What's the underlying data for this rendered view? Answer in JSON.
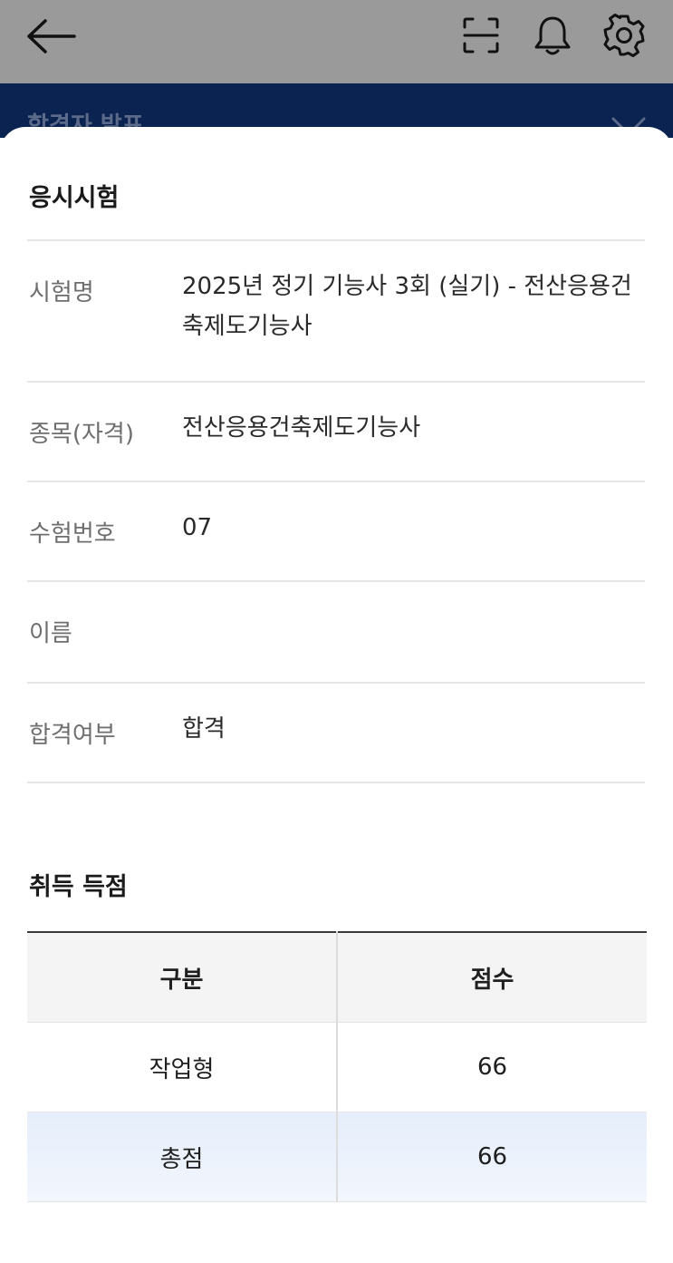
{
  "header": {
    "back_icon": "arrow-left-icon",
    "scan_icon": "scan-icon",
    "bell_icon": "bell-icon",
    "gear_icon": "gear-icon"
  },
  "behind_title": "합격자 발표",
  "exam": {
    "section_title": "응시시험",
    "rows": [
      {
        "label": "시험명",
        "value": "2025년 정기 기능사 3회 (실기) - 전산응용건축제도기능사"
      },
      {
        "label": "종목(자격)",
        "value": "전산응용건축제도기능사"
      },
      {
        "label": "수험번호",
        "value": "07"
      },
      {
        "label": "이름",
        "value": ""
      },
      {
        "label": "합격여부",
        "value": "합격"
      }
    ]
  },
  "scores": {
    "section_title": "취득 득점",
    "headers": [
      "구분",
      "점수"
    ],
    "rows": [
      {
        "category": "작업형",
        "score": "66"
      },
      {
        "category": "총점",
        "score": "66"
      }
    ]
  },
  "colors": {
    "topbar": "#9a9a9a",
    "navy": "#0b2350",
    "total_row": "#e9f0fb"
  }
}
